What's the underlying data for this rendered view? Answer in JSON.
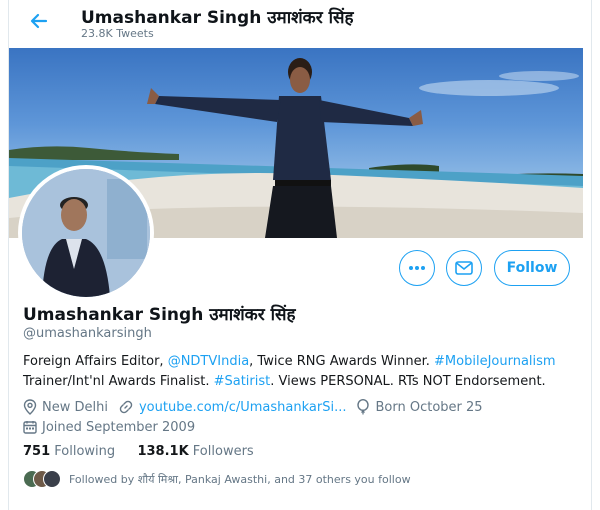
{
  "header": {
    "name": "Umashankar Singh उमाशंकर सिंह",
    "tweet_count": "23.8K Tweets"
  },
  "profile": {
    "name": "Umashankar Singh उमाशंकर सिंह",
    "handle": "@umashankarsingh",
    "follow_label": "Follow",
    "bio": {
      "t1": "Foreign Affairs Editor, ",
      "l1": "@NDTVIndia",
      "t2": ", Twice RNG Awards Winner. ",
      "l2": "#MobileJournalism",
      "t3": " Trainer/Int'nl Awards Finalist. ",
      "l3": "#Satirist",
      "t4": ". Views PERSONAL. RTs NOT Endorsement."
    },
    "location": "New Delhi",
    "website": "youtube.com/c/UmashankarSi...",
    "birth": "Born October 25",
    "joined": "Joined September 2009",
    "following_count": "751",
    "following_label": "Following",
    "followers_count": "138.1K",
    "followers_label": "Followers",
    "followed_by": "Followed by शौर्य मिश्रा, Pankaj Awasthi, and 37 others you follow"
  },
  "colors": {
    "accent": "#1da1f2",
    "secondary_text": "#657786"
  }
}
